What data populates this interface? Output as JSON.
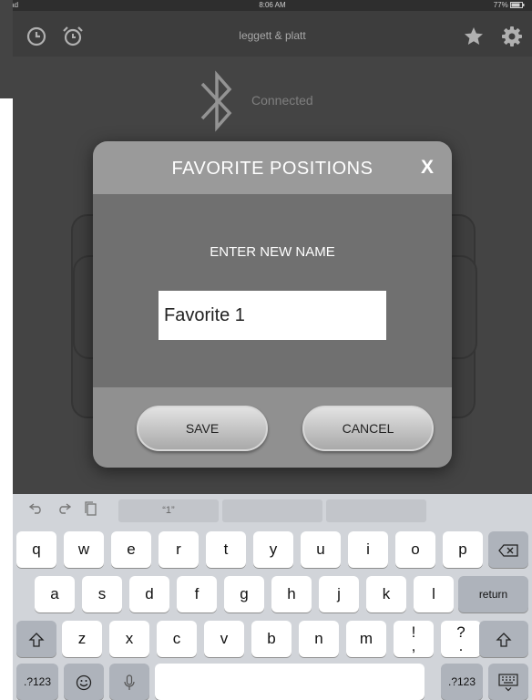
{
  "status_bar": {
    "device": "iPad",
    "time": "8:06 AM",
    "battery": "77%"
  },
  "header": {
    "title": "leggett & platt",
    "icons": [
      "clock-icon",
      "alarm-icon",
      "star-icon",
      "gear-icon"
    ]
  },
  "bluetooth": {
    "icon": "bluetooth-icon",
    "status": "Connected"
  },
  "modal": {
    "title": "FAVORITE POSITIONS",
    "close_label": "X",
    "prompt": "ENTER NEW NAME",
    "input_value": "Favorite 1",
    "save_label": "SAVE",
    "cancel_label": "CANCEL"
  },
  "keyboard": {
    "suggestion": "“1”",
    "row1": [
      "q",
      "w",
      "e",
      "r",
      "t",
      "y",
      "u",
      "i",
      "o",
      "p"
    ],
    "row2": [
      "a",
      "s",
      "d",
      "f",
      "g",
      "h",
      "j",
      "k",
      "l"
    ],
    "row3": [
      "z",
      "x",
      "c",
      "v",
      "b",
      "n",
      "m",
      "!\n,",
      "?\n."
    ],
    "return_label": "return",
    "numbers_label": ".?123",
    "colors": {
      "key": "#ffffff",
      "dark_key": "#aeb3bb",
      "background": "#d1d4d9"
    }
  },
  "colors": {
    "app_bg": "#4a4a4a",
    "modal_header": "#9a9a9a",
    "modal_body": "#707070",
    "modal_footer": "#909090"
  }
}
